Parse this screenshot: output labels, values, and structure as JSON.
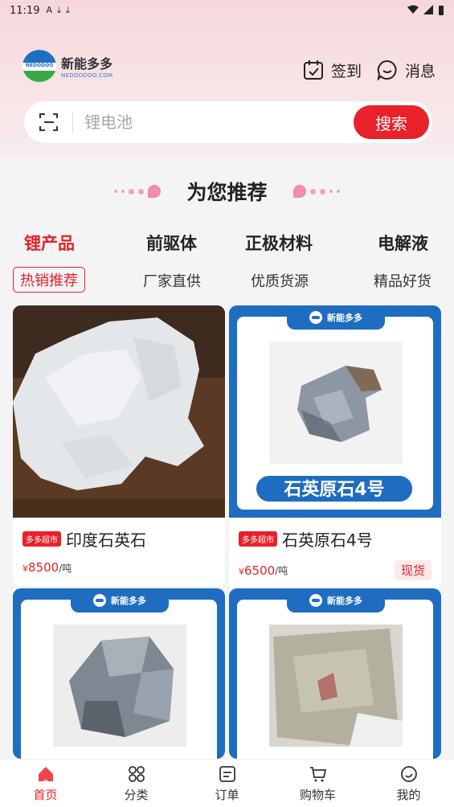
{
  "status_bar": {
    "time": "11:19",
    "left_icons": [
      "A",
      "⤓",
      "⤓"
    ],
    "right_icons": [
      "wifi-icon",
      "signal-icon",
      "battery-icon"
    ]
  },
  "header": {
    "logo_cn": "新能多多",
    "logo_en": "NEDDODOO.COM",
    "logo_mark_text": "NEDODOO",
    "checkin_label": "签到",
    "messages_label": "消息"
  },
  "search": {
    "placeholder": "锂电池",
    "button_label": "搜索"
  },
  "section_title": "为您推荐",
  "category_tabs": [
    {
      "label": "锂产品",
      "active": true
    },
    {
      "label": "前驱体",
      "active": false
    },
    {
      "label": "正极材料",
      "active": false
    },
    {
      "label": "电解液",
      "active": false
    }
  ],
  "sub_tabs": [
    {
      "label": "热销推荐",
      "active": true
    },
    {
      "label": "厂家直供",
      "active": false
    },
    {
      "label": "优质货源",
      "active": false
    },
    {
      "label": "精品好货",
      "active": false
    }
  ],
  "products": [
    {
      "store_badge": "多多超市",
      "title": "印度石英石",
      "price_symbol": "¥",
      "price": "8500",
      "unit": "/吨",
      "stock": ""
    },
    {
      "store_badge": "多多超市",
      "title": "石英原石4号",
      "price_symbol": "¥",
      "price": "6500",
      "unit": "/吨",
      "stock": "现货",
      "frame_brand": "新能多多",
      "frame_label": "石英原石4号"
    },
    {
      "frame_brand": "新能多多"
    },
    {
      "frame_brand": "新能多多"
    }
  ],
  "bottom_nav": [
    {
      "label": "首页",
      "icon": "home-icon",
      "active": true
    },
    {
      "label": "分类",
      "icon": "category-icon",
      "active": false
    },
    {
      "label": "订单",
      "icon": "order-icon",
      "active": false
    },
    {
      "label": "购物车",
      "icon": "cart-icon",
      "active": false
    },
    {
      "label": "我的",
      "icon": "profile-icon",
      "active": false
    }
  ],
  "colors": {
    "accent": "#e8212a",
    "brand_blue": "#1e6dc0",
    "header_pink": "#f6d8dc"
  }
}
